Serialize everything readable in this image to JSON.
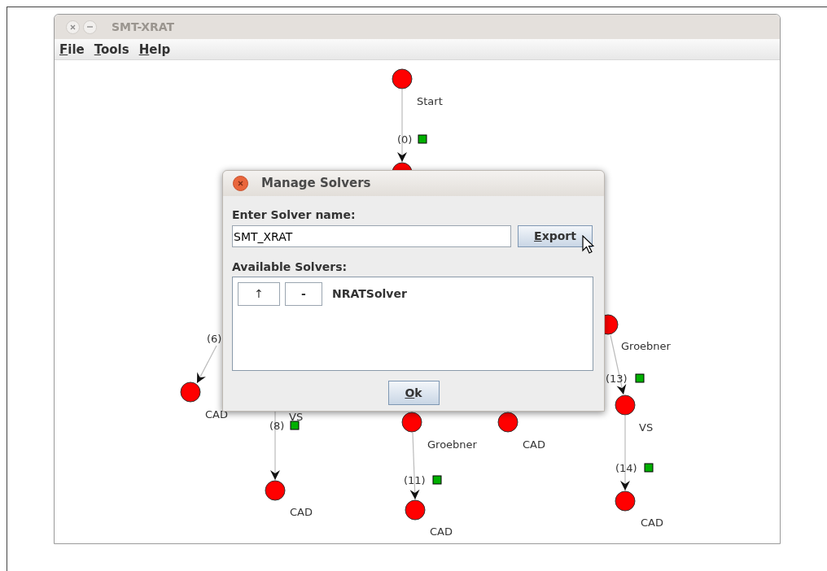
{
  "window": {
    "title": "SMT-XRAT"
  },
  "menu": [
    {
      "label": "File"
    },
    {
      "label": "Tools"
    },
    {
      "label": "Help"
    }
  ],
  "graph": {
    "nodes": [
      {
        "label": "Start"
      },
      {
        "label": "CAD"
      },
      {
        "label": "VS"
      },
      {
        "label": "CAD"
      },
      {
        "label": "Groebner"
      },
      {
        "label": "CAD"
      },
      {
        "label": "CAD"
      },
      {
        "label": "Groebner"
      },
      {
        "label": "VS"
      },
      {
        "label": "CAD"
      }
    ],
    "edges": [
      {
        "label": "(0)"
      },
      {
        "label": "(6)"
      },
      {
        "label": "(8)"
      },
      {
        "label": "(11)"
      },
      {
        "label": "(13)"
      },
      {
        "label": "(14)"
      }
    ]
  },
  "dialog": {
    "title": "Manage Solvers",
    "name_label": "Enter Solver name:",
    "name_value": "SMT_XRAT",
    "export_button": "Export",
    "list_label": "Available Solvers:",
    "solvers": [
      {
        "up_button": "↑",
        "remove_button": "-",
        "name": "NRATSolver"
      }
    ],
    "ok_button": "Ok"
  }
}
